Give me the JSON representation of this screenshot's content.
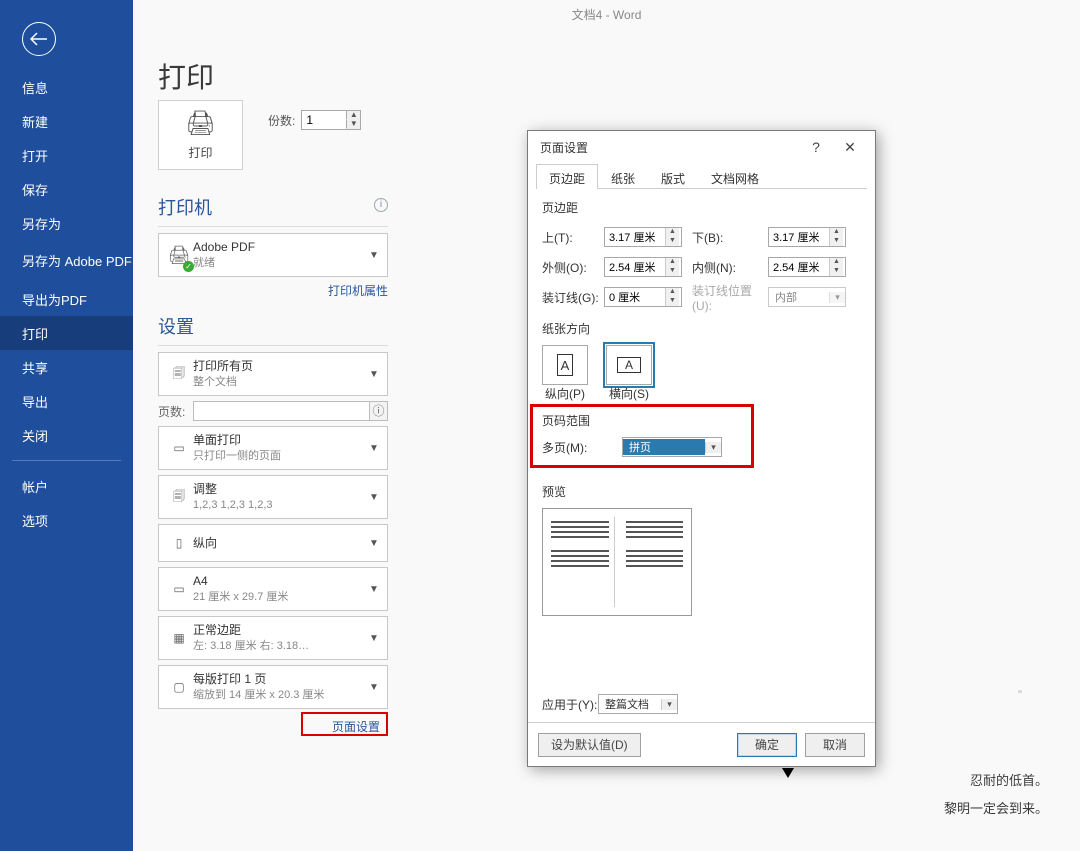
{
  "app_title": "文档4 - Word",
  "page_heading": "打印",
  "sidebar": {
    "items": [
      {
        "label": "信息"
      },
      {
        "label": "新建"
      },
      {
        "label": "打开"
      },
      {
        "label": "保存"
      },
      {
        "label": "另存为"
      },
      {
        "label": "另存为 Adobe PDF"
      },
      {
        "label": "导出为PDF"
      },
      {
        "label": "打印"
      },
      {
        "label": "共享"
      },
      {
        "label": "导出"
      },
      {
        "label": "关闭"
      }
    ],
    "lower": [
      {
        "label": "帐户"
      },
      {
        "label": "选项"
      }
    ]
  },
  "print": {
    "print_btn": "打印",
    "copies_label": "份数:",
    "copies_value": "1",
    "printer_heading": "打印机",
    "printer_name": "Adobe PDF",
    "printer_status": "就绪",
    "printer_props": "打印机属性",
    "settings_heading": "设置",
    "dd1_t1": "打印所有页",
    "dd1_t2": "整个文档",
    "pages_label": "页数:",
    "dd2_t1": "单面打印",
    "dd2_t2": "只打印一侧的页面",
    "dd3_t1": "调整",
    "dd3_t2": "1,2,3    1,2,3    1,2,3",
    "dd4_t1": "纵向",
    "dd5_t1": "A4",
    "dd5_t2": "21 厘米 x 29.7 厘米",
    "dd6_t1": "正常边距",
    "dd6_t2": "左:  3.18 厘米   右:  3.18…",
    "dd7_t1": "每版打印 1 页",
    "dd7_t2": "缩放到 14 厘米 x 20.3 厘米",
    "page_setup_link": "页面设置"
  },
  "dialog": {
    "title": "页面设置",
    "help": "?",
    "close": "✕",
    "tabs": [
      "页边距",
      "纸张",
      "版式",
      "文档网格"
    ],
    "active_tab": 0,
    "margins_heading": "页边距",
    "top_label": "上(T):",
    "top_value": "3.17 厘米",
    "bottom_label": "下(B):",
    "bottom_value": "3.17 厘米",
    "outer_label": "外侧(O):",
    "outer_value": "2.54 厘米",
    "inner_label": "内侧(N):",
    "inner_value": "2.54 厘米",
    "gutter_label": "装订线(G):",
    "gutter_value": "0 厘米",
    "gutter_pos_label": "装订线位置(U):",
    "gutter_pos_value": "内部",
    "orient_heading": "纸张方向",
    "portrait": "纵向(P)",
    "landscape": "横向(S)",
    "range_heading": "页码范围",
    "multi_label": "多页(M):",
    "multi_value": "拼页",
    "preview_heading": "预览",
    "apply_label": "应用于(Y):",
    "apply_value": "整篇文档",
    "default_btn": "设为默认值(D)",
    "ok_btn": "确定",
    "cancel_btn": "取消"
  },
  "behind": {
    "line1": "忍耐的低首。",
    "line2": "黎明一定会到来。"
  }
}
